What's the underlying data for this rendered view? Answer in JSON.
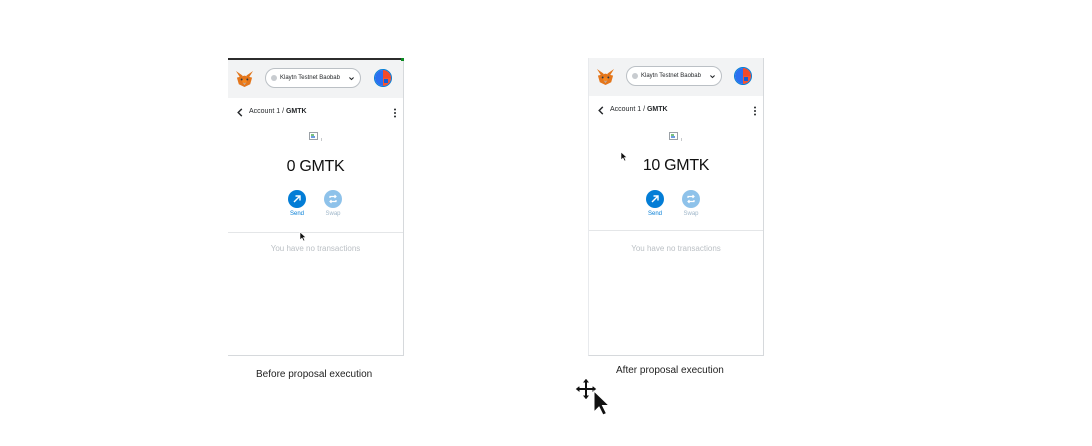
{
  "panels": [
    {
      "network": "Klaytn Testnet Baobab",
      "breadcrumb_account": "Account 1 /",
      "breadcrumb_token": "GMTK",
      "balance": "0 GMTK",
      "send_label": "Send",
      "swap_label": "Swap",
      "empty_message": "You have no transactions",
      "caption": "Before proposal execution"
    },
    {
      "network": "Klaytn Testnet Baobab",
      "breadcrumb_account": "Account 1 /",
      "breadcrumb_token": "GMTK",
      "balance": "10 GMTK",
      "send_label": "Send",
      "swap_label": "Swap",
      "empty_message": "You have no transactions",
      "caption": "After proposal execution"
    }
  ],
  "colors": {
    "accent": "#037dd6",
    "swap_disabled": "#8ec2ea",
    "header_bg": "#f2f3f4"
  },
  "icons": [
    "metamask-fox-icon",
    "network-dot-icon",
    "chevron-down-icon",
    "account-avatar-icon",
    "back-arrow-icon",
    "kebab-menu-icon",
    "broken-image-icon",
    "send-arrow-icon",
    "swap-arrows-icon",
    "mouse-pointer-icon",
    "move-cursor-icon"
  ]
}
